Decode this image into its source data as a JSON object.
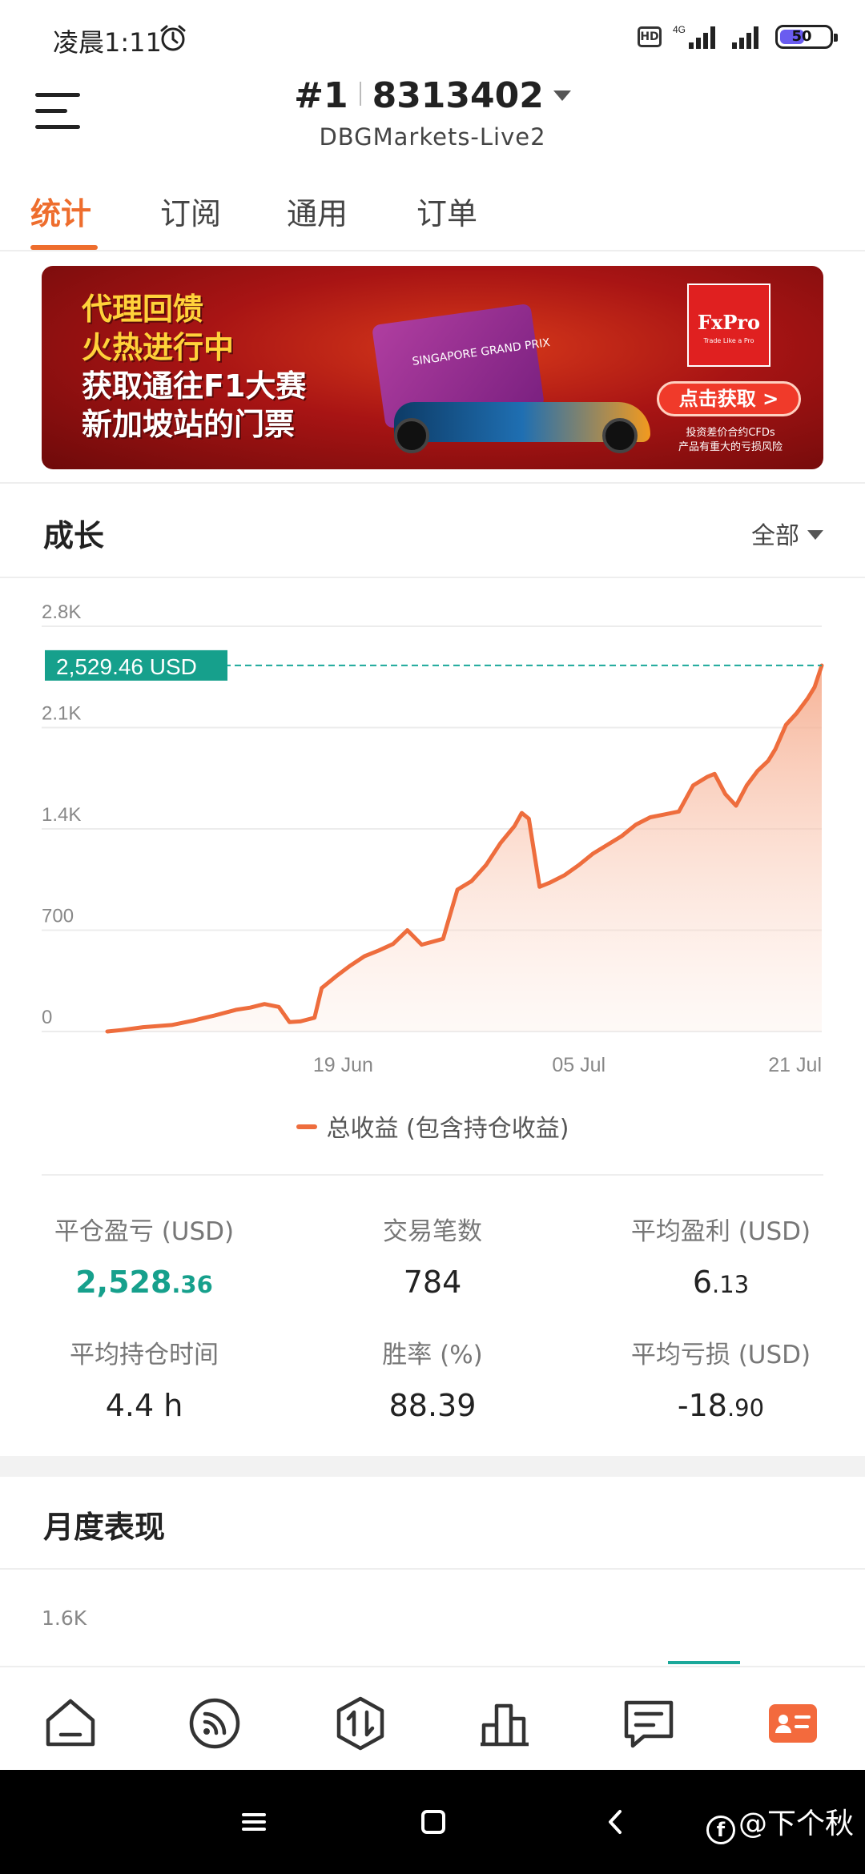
{
  "status_bar": {
    "time": "凌晨1:11",
    "hd": "HD",
    "network": "4G",
    "battery_level": "50",
    "battery_fraction": 0.5
  },
  "header": {
    "account_rank": "#1",
    "account_number": "8313402",
    "server": "DBGMarkets-Live2",
    "menu_icon": "hamburger-menu-icon"
  },
  "tabs": [
    {
      "label": "统计",
      "active": true
    },
    {
      "label": "订阅",
      "active": false
    },
    {
      "label": "通用",
      "active": false
    },
    {
      "label": "订单",
      "active": false
    }
  ],
  "banner": {
    "lines": [
      "代理回馈",
      "火热进行中",
      "获取通往F1大赛",
      "新加坡站的门票"
    ],
    "ticket_text": "SINGAPORE GRAND PRIX",
    "brand": "FxPro",
    "brand_tagline": "Trade Like a Pro",
    "cta": "点击获取 >",
    "risk_line1": "投资差价合约CFDs",
    "risk_line2": "产品有重大的亏损风险"
  },
  "growth": {
    "title": "成长",
    "range": "全部"
  },
  "chart_data": {
    "type": "area",
    "y_ticks": [
      "2.8K",
      "2.1K",
      "1.4K",
      "700",
      "0"
    ],
    "y_tick_values": [
      2800,
      2100,
      1400,
      700,
      0
    ],
    "x_ticks": [
      "19 Jun",
      "05 Jul",
      "21 Jul"
    ],
    "ylim": [
      0,
      2800
    ],
    "current_value_label": "2,529.46 USD",
    "current_value": 2529.46,
    "series": [
      {
        "name": "总收益 (包含持仓收益)",
        "color": "#ee6d3d",
        "points": [
          [
            0.0,
            0
          ],
          [
            0.02,
            10
          ],
          [
            0.05,
            30
          ],
          [
            0.09,
            45
          ],
          [
            0.12,
            75
          ],
          [
            0.15,
            110
          ],
          [
            0.18,
            150
          ],
          [
            0.2,
            165
          ],
          [
            0.22,
            190
          ],
          [
            0.24,
            170
          ],
          [
            0.255,
            65
          ],
          [
            0.27,
            70
          ],
          [
            0.29,
            95
          ],
          [
            0.3,
            300
          ],
          [
            0.32,
            380
          ],
          [
            0.34,
            455
          ],
          [
            0.36,
            520
          ],
          [
            0.38,
            560
          ],
          [
            0.4,
            605
          ],
          [
            0.42,
            700
          ],
          [
            0.44,
            600
          ],
          [
            0.47,
            640
          ],
          [
            0.49,
            980
          ],
          [
            0.51,
            1040
          ],
          [
            0.53,
            1150
          ],
          [
            0.55,
            1300
          ],
          [
            0.57,
            1420
          ],
          [
            0.58,
            1510
          ],
          [
            0.59,
            1470
          ],
          [
            0.605,
            1000
          ],
          [
            0.62,
            1030
          ],
          [
            0.64,
            1080
          ],
          [
            0.66,
            1150
          ],
          [
            0.68,
            1230
          ],
          [
            0.7,
            1290
          ],
          [
            0.72,
            1350
          ],
          [
            0.74,
            1430
          ],
          [
            0.76,
            1480
          ],
          [
            0.78,
            1500
          ],
          [
            0.8,
            1520
          ],
          [
            0.82,
            1700
          ],
          [
            0.84,
            1760
          ],
          [
            0.85,
            1780
          ],
          [
            0.865,
            1640
          ],
          [
            0.88,
            1560
          ],
          [
            0.895,
            1700
          ],
          [
            0.91,
            1800
          ],
          [
            0.925,
            1870
          ],
          [
            0.935,
            1950
          ],
          [
            0.95,
            2120
          ],
          [
            0.965,
            2200
          ],
          [
            0.98,
            2300
          ],
          [
            0.99,
            2380
          ],
          [
            1.0,
            2529
          ]
        ]
      }
    ],
    "x_tick_positions": [
      0.33,
      0.66,
      1.0
    ],
    "grid": true,
    "legend": "bottom-center"
  },
  "stats": [
    {
      "label": "平仓盈亏 (USD)",
      "int": "2,528",
      "dec": ".36",
      "highlight": true
    },
    {
      "label": "交易笔数",
      "int": "784",
      "dec": "",
      "highlight": false
    },
    {
      "label": "平均盈利 (USD)",
      "int": "6",
      "dec": ".13",
      "highlight": false
    },
    {
      "label": "平均持仓时间",
      "int": "4.4 h",
      "dec": "",
      "highlight": false
    },
    {
      "label": "胜率 (%)",
      "int": "88.39",
      "dec": "",
      "highlight": false
    },
    {
      "label": "平均亏损 (USD)",
      "int": "-18",
      "dec": ".90",
      "highlight": false
    }
  ],
  "monthly": {
    "title": "月度表现",
    "top_tick": "1.6K"
  },
  "bottom_nav": [
    {
      "name": "home-icon",
      "active": false
    },
    {
      "name": "signal-feed-icon",
      "active": false
    },
    {
      "name": "trade-icon",
      "active": false
    },
    {
      "name": "bar-chart-icon",
      "active": false
    },
    {
      "name": "message-icon",
      "active": false
    },
    {
      "name": "account-card-icon",
      "active": true
    }
  ],
  "colors": {
    "accent": "#ee6d2d",
    "profit_green": "#16a08c",
    "chart_line": "#ee6d3d"
  },
  "watermark": "@下个秋"
}
